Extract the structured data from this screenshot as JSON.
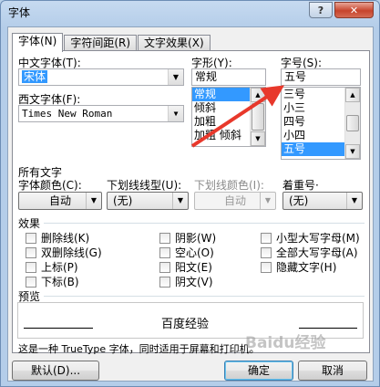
{
  "window": {
    "title": "字体",
    "help_label": "?",
    "close_label": "✕"
  },
  "tabs": [
    {
      "label": "字体(N)",
      "active": true
    },
    {
      "label": "字符间距(R)",
      "active": false
    },
    {
      "label": "文字效果(X)",
      "active": false
    }
  ],
  "font": {
    "chinese_label": "中文字体(T):",
    "chinese_value": "宋体",
    "western_label": "西文字体(F):",
    "western_value": "Times New Roman"
  },
  "style": {
    "label": "字形(Y):",
    "value": "常规",
    "items": [
      "常规",
      "倾斜",
      "加粗",
      "加粗 倾斜"
    ],
    "selected": 0
  },
  "size": {
    "label": "字号(S):",
    "value": "五号",
    "items": [
      "三号",
      "小三",
      "四号",
      "小四",
      "五号"
    ],
    "selected": 4
  },
  "all_text": {
    "heading": "所有文字",
    "color_label": "字体颜色(C):",
    "color_value": "自动",
    "underline_label": "下划线线型(U):",
    "underline_value": "(无)",
    "underline_color_label": "下划线颜色(I):",
    "underline_color_value": "自动",
    "emphasis_label": "着重号·",
    "emphasis_value": "(无)"
  },
  "effects": {
    "heading": "效果",
    "col1": [
      "删除线(K)",
      "双删除线(G)",
      "上标(P)",
      "下标(B)"
    ],
    "col2": [
      "阴影(W)",
      "空心(O)",
      "阳文(E)",
      "阴文(V)"
    ],
    "col3": [
      "小型大写字母(M)",
      "全部大写字母(A)",
      "隐藏文字(H)"
    ]
  },
  "preview": {
    "heading": "预览",
    "text": "百度经验",
    "note": "这是一种 TrueType 字体，同时适用于屏幕和打印机。"
  },
  "buttons": {
    "default_label": "默认(D)...",
    "ok_label": "确定",
    "cancel_label": "取消"
  },
  "watermark": "Baidu经验",
  "colors": {
    "annotation_arrow": "#e8382b",
    "selection": "#3399ff"
  }
}
